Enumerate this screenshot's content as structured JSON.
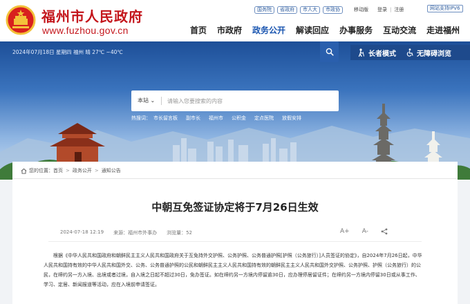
{
  "header": {
    "site_name": "福州市人民政府",
    "site_url": "www.fuzhou.gov.cn",
    "top_links": [
      "国务院",
      "省政府",
      "市人大",
      "市政协"
    ],
    "mobile_label": "移动版",
    "login_label": "登录",
    "register_label": "注册",
    "ipv6_label": "网站支持IPV6",
    "nav": [
      "首页",
      "市政府",
      "政务公开",
      "解读回应",
      "办事服务",
      "互动交流",
      "走进福州"
    ],
    "active_nav": "政务公开"
  },
  "banner": {
    "date_weather": "2024年07月18日 星期四  福州 晴 27℃ ~40℃",
    "elder_mode": "长者模式",
    "accessible_mode": "无障碍浏览",
    "search_scope": "本站",
    "search_placeholder": "请输入您要搜索的内容",
    "hot_label": "热搜词：",
    "hot_words": [
      "市长留言板",
      "副市长",
      "福州市",
      "公积金",
      "定点医院",
      "放假安排"
    ]
  },
  "breadcrumb": {
    "prefix": "您的位置：",
    "items": [
      "首页",
      "政务公开",
      "通知公告"
    ]
  },
  "article": {
    "title": "中朝互免签证协定将于7月26日生效",
    "date": "2024-07-18 12:19",
    "source": "来源：福州市外事办",
    "views": "浏览量：52",
    "tools": [
      "A+",
      "A-",
      "share-icon"
    ],
    "body": "根据《中华人民共和国政府和朝鲜民主主义人民共和国政府关于互免持外交护照、公务护照、公务普通护照[护照（公务旅行）]人员签证的协定》，自2024年7月26日起，中华人民共和国持有效的中华人民共和国外交、公务、公务普通护照的公民和朝鲜民主主义人民共和国持有效的朝鲜民主主义人民共和国外交护照、公务护照、护照（公务旅行）的公民，在缔约另一方入境、出境或者过境，自入境之日起不超过30日，免办签证。如在缔约另一方境内停留逾30日，应办理停居留证件；在缔约另一方境内停留30日或从事工作、学习、定居、新闻报道等活动，应在入境前申请签证。"
  },
  "colors": {
    "brand_red": "#c4161c",
    "nav_blue": "#1a55b0",
    "mode_bar": "#1e4a8c"
  }
}
